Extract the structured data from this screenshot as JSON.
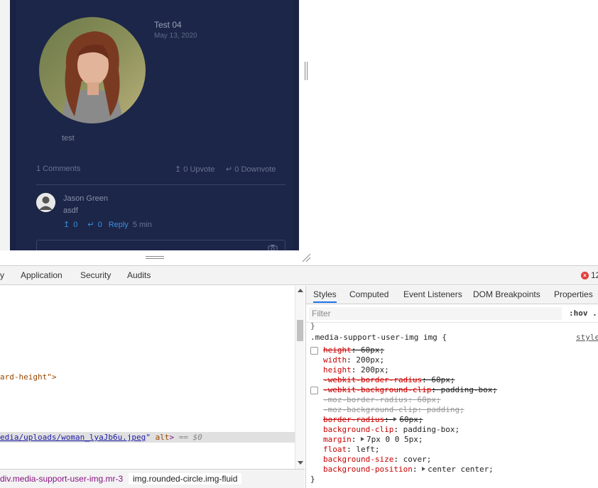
{
  "post": {
    "title": "Test 04",
    "date": "May 13, 2020",
    "body": "test",
    "comments_count": "1 Comments",
    "upvote": "0 Upvote",
    "downvote": "0 Downvote"
  },
  "comment": {
    "author": "Jason Green",
    "text": "asdf",
    "upvotes": "0",
    "downvotes": "0",
    "reply_label": "Reply",
    "time": "5 min"
  },
  "devtools": {
    "tabs": [
      "y",
      "Application",
      "Security",
      "Audits"
    ],
    "error_count": "12",
    "elements": {
      "line1": "ard-height\">",
      "selected_src": "edia/uploads/woman_lyaJb6u.jpeg",
      "selected_attr": "alt",
      "selected_suffix": "== $0"
    },
    "breadcrumbs": [
      "div.media-support-user-img.mr-3",
      "img.rounded-circle.img-fluid"
    ],
    "styles_tabs": [
      "Styles",
      "Computed",
      "Event Listeners",
      "DOM Breakpoints",
      "Properties"
    ],
    "filter_placeholder": "Filter",
    "hov_label": ":hov",
    "hov_extra": ".",
    "rule_link": "style",
    "selector": ".media-support-user-img img {",
    "closing": "}",
    "top_brace": "}",
    "declarations": [
      {
        "name": "height",
        "value": "60px;",
        "struck": true
      },
      {
        "name": "width",
        "value": "200px;",
        "struck": false
      },
      {
        "name": "height",
        "value": "200px;",
        "struck": false
      },
      {
        "name": "-webkit-border-radius",
        "value": "60px;",
        "struck": true
      },
      {
        "name": "-webkit-background-clip",
        "value": "padding-box;",
        "struck": true
      },
      {
        "name": "-moz-border-radius",
        "value": "60px;",
        "struck": true,
        "dim": true
      },
      {
        "name": "-moz-background-clip",
        "value": "padding;",
        "struck": true,
        "dim": true
      },
      {
        "name": "border-radius",
        "value": "60px;",
        "struck": true
      },
      {
        "name": "background-clip",
        "value": "padding-box;",
        "struck": false
      },
      {
        "name": "margin",
        "value": "7px 0 0 5px;",
        "struck": false
      },
      {
        "name": "float",
        "value": "left;",
        "struck": false
      },
      {
        "name": "background-size",
        "value": "cover;",
        "struck": false
      },
      {
        "name": "background-position",
        "value": "center center;",
        "struck": false
      }
    ]
  },
  "colors": {
    "card_bg": "#1c2648",
    "accent_blue": "#3d8ee0",
    "css_prop": "#c80000"
  }
}
